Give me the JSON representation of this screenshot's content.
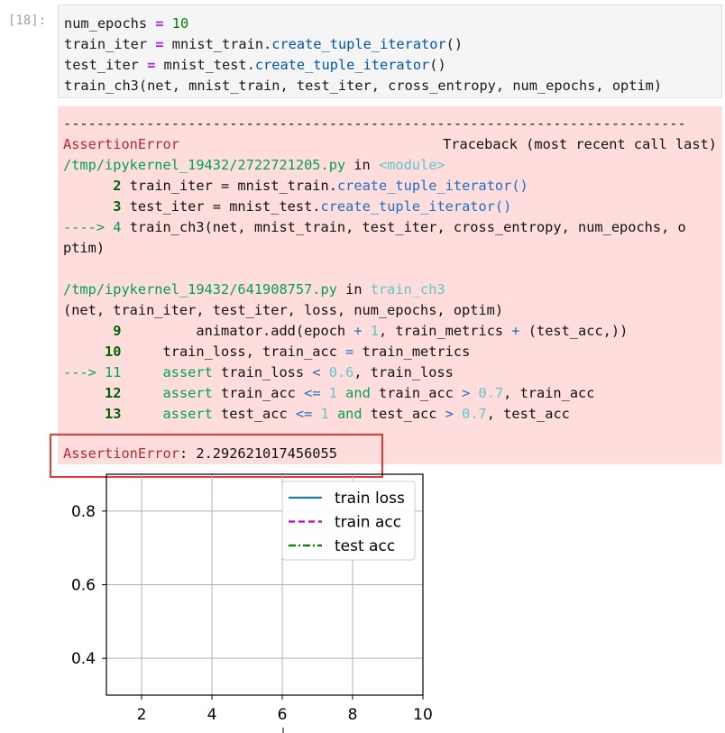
{
  "cell": {
    "prompt": "[18]:",
    "code": {
      "l1": {
        "a": "num_epochs ",
        "op": "=",
        "b": " ",
        "num": "10"
      },
      "l2": {
        "a": "train_iter ",
        "op": "=",
        "b": " mnist_train.",
        "fn": "create_tuple_iterator",
        "c": "()"
      },
      "l3": {
        "a": "test_iter ",
        "op": "=",
        "b": " mnist_test.",
        "fn": "create_tuple_iterator",
        "c": "()"
      },
      "l4": "train_ch3(net, mnist_train, test_iter, cross_entropy, num_epochs, optim)"
    }
  },
  "traceback": {
    "dashes": "---------------------------------------------------------------------------",
    "error_name": "AssertionError",
    "header_right": "Traceback (most recent call last)",
    "file1": {
      "path": "/tmp/ipykernel_19432/2722721205.py",
      "in": " in ",
      "where": "<module>"
    },
    "f1l2": {
      "num": "      2 ",
      "a": "train_iter = mnist_train.",
      "fn": "create_tuple_iterator",
      "b": "()"
    },
    "f1l3": {
      "num": "      3 ",
      "a": "test_iter = mnist_test.",
      "fn": "create_tuple_iterator",
      "b": "()"
    },
    "f1l4": {
      "arrow": "----> 4 ",
      "a": "train_ch3(net, mnist_train, test_iter, cross_entropy, num_epochs, o"
    },
    "f1l4b": "ptim)",
    "file2": {
      "path": "/tmp/ipykernel_19432/641908757.py",
      "in": " in ",
      "where": "train_ch3"
    },
    "sig": "(net, train_iter, test_iter, loss, num_epochs, optim)",
    "f2l9": {
      "num": "      9 ",
      "a": "        animator.add(epoch ",
      "op": "+",
      "n1": " 1",
      "b": ", train_metrics ",
      "op2": "+",
      "c": " (test_acc,))"
    },
    "f2l10": {
      "num": "     10 ",
      "a": "    train_loss, train_acc ",
      "op": "=",
      "b": " train_metrics"
    },
    "f2l11": {
      "arrow": "---> 11 ",
      "kw": "    assert",
      "a": " train_loss ",
      "op": "<",
      "n": " 0.6",
      "b": ", train_loss"
    },
    "f2l12": {
      "num": "     12 ",
      "kw": "    assert",
      "a": " train_acc ",
      "op": "<=",
      "n": " 1",
      "and": " and",
      "b": " train_acc ",
      "op2": ">",
      "n2": " 0.7",
      "c": ", train_acc"
    },
    "f2l13": {
      "num": "     13 ",
      "kw": "    assert",
      "a": " test_acc ",
      "op": "<=",
      "n": " 1",
      "and": " and",
      "b": " test_acc ",
      "op2": ">",
      "n2": " 0.7",
      "c": ", test_acc"
    },
    "final": {
      "name": "AssertionError",
      "msg": ": 2.292621017456055"
    }
  },
  "chart_data": {
    "type": "line",
    "xlim": [
      1,
      10
    ],
    "ylim": [
      0.3,
      0.9
    ],
    "xticks": [
      "2",
      "4",
      "6",
      "8",
      "10"
    ],
    "yticks": [
      "0.8",
      "0.6",
      "0.4"
    ],
    "grid": true,
    "legend_position": "upper-right",
    "series": [
      {
        "name": "train loss",
        "color": "#1f77b4",
        "style": "solid",
        "values": []
      },
      {
        "name": "train acc",
        "color": "#bf00bf",
        "style": "dashed",
        "values": []
      },
      {
        "name": "test acc",
        "color": "#008000",
        "style": "dash-dot",
        "values": []
      }
    ]
  }
}
